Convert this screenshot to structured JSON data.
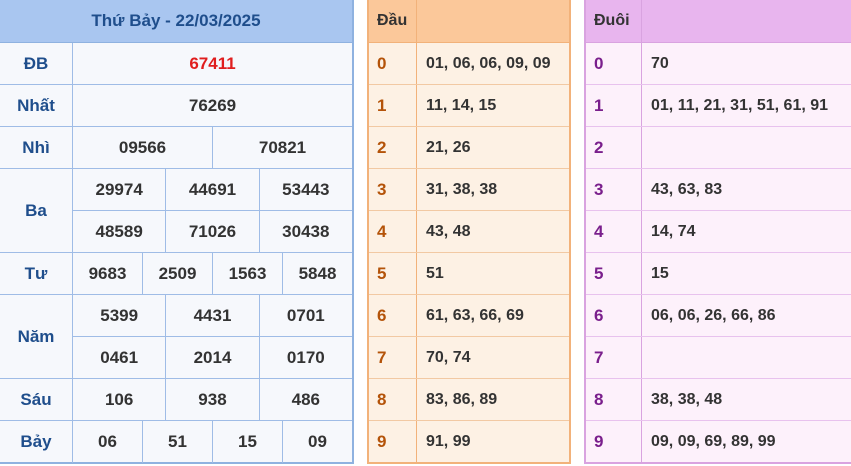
{
  "results": {
    "title": "Thứ Bảy - 22/03/2025",
    "prizes": [
      {
        "label": "ĐB",
        "lines": [
          [
            "67411"
          ]
        ],
        "special": true
      },
      {
        "label": "Nhất",
        "lines": [
          [
            "76269"
          ]
        ]
      },
      {
        "label": "Nhì",
        "lines": [
          [
            "09566",
            "70821"
          ]
        ]
      },
      {
        "label": "Ba",
        "lines": [
          [
            "29974",
            "44691",
            "53443"
          ],
          [
            "48589",
            "71026",
            "30438"
          ]
        ]
      },
      {
        "label": "Tư",
        "lines": [
          [
            "9683",
            "2509",
            "1563",
            "5848"
          ]
        ]
      },
      {
        "label": "Năm",
        "lines": [
          [
            "5399",
            "4431",
            "0701"
          ],
          [
            "0461",
            "2014",
            "0170"
          ]
        ]
      },
      {
        "label": "Sáu",
        "lines": [
          [
            "106",
            "938",
            "486"
          ]
        ]
      },
      {
        "label": "Bảy",
        "lines": [
          [
            "06",
            "51",
            "15",
            "09"
          ]
        ]
      }
    ]
  },
  "dau": {
    "header": "Đầu",
    "rows": [
      {
        "key": "0",
        "value": "01, 06, 06, 09, 09"
      },
      {
        "key": "1",
        "value": "11, 14, 15"
      },
      {
        "key": "2",
        "value": "21, 26"
      },
      {
        "key": "3",
        "value": "31, 38, 38"
      },
      {
        "key": "4",
        "value": "43, 48"
      },
      {
        "key": "5",
        "value": "51"
      },
      {
        "key": "6",
        "value": "61, 63, 66, 69"
      },
      {
        "key": "7",
        "value": "70, 74"
      },
      {
        "key": "8",
        "value": "83, 86, 89"
      },
      {
        "key": "9",
        "value": "91, 99"
      }
    ]
  },
  "duoi": {
    "header": "Đuôi",
    "rows": [
      {
        "key": "0",
        "value": "70"
      },
      {
        "key": "1",
        "value": "01, 11, 21, 31, 51, 61, 91"
      },
      {
        "key": "2",
        "value": ""
      },
      {
        "key": "3",
        "value": "43, 63, 83"
      },
      {
        "key": "4",
        "value": "14, 74"
      },
      {
        "key": "5",
        "value": "15"
      },
      {
        "key": "6",
        "value": "06, 06, 26, 66, 86"
      },
      {
        "key": "7",
        "value": ""
      },
      {
        "key": "8",
        "value": "38, 38, 48"
      },
      {
        "key": "9",
        "value": "09, 09, 69, 89, 99"
      }
    ]
  },
  "colors": {
    "special_prize": "#e01e1e",
    "results_header": "#a9c6f0",
    "dau_header": "#fbc89a",
    "duoi_header": "#e8b5ee"
  }
}
